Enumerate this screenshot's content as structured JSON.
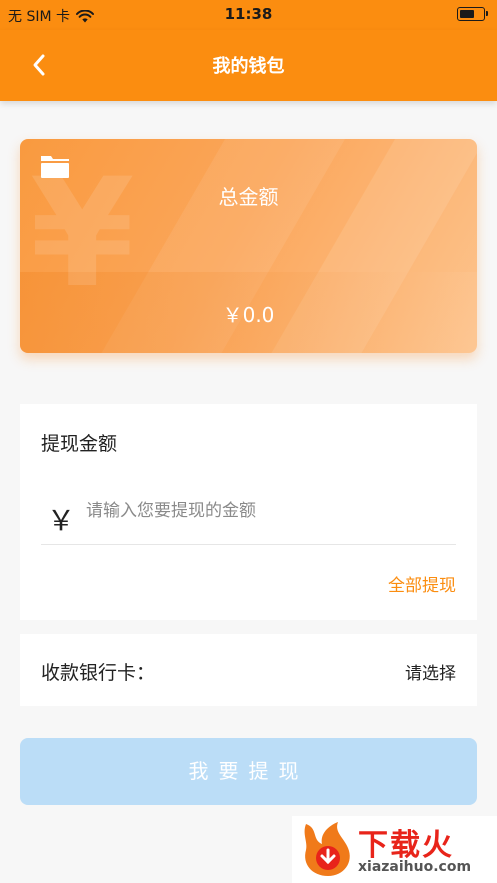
{
  "status_bar": {
    "carrier": "无 SIM 卡",
    "time": "11:38",
    "battery_level": 0.65,
    "icons": [
      "wifi-icon",
      "battery-icon"
    ]
  },
  "nav": {
    "title": "我的钱包",
    "back_icon": "chevron-left-icon"
  },
  "wallet": {
    "icon": "folder-icon",
    "watermark_symbol": "¥",
    "total_label": "总金额",
    "total_amount": "￥0.0"
  },
  "withdraw": {
    "heading": "提现金额",
    "currency_symbol": "￥",
    "amount_value": "",
    "amount_placeholder": "请输入您要提现的金额",
    "withdraw_all_label": "全部提现"
  },
  "bank": {
    "label": "收款银行卡：",
    "value": "请选择"
  },
  "submit": {
    "label": "我要提现"
  },
  "watermark": {
    "brand": "下载火",
    "domain": "xiazaihuo.com"
  },
  "colors": {
    "accent": "#fb8d10",
    "button_disabled": "#bbddf7",
    "background": "#f7f7f7"
  }
}
